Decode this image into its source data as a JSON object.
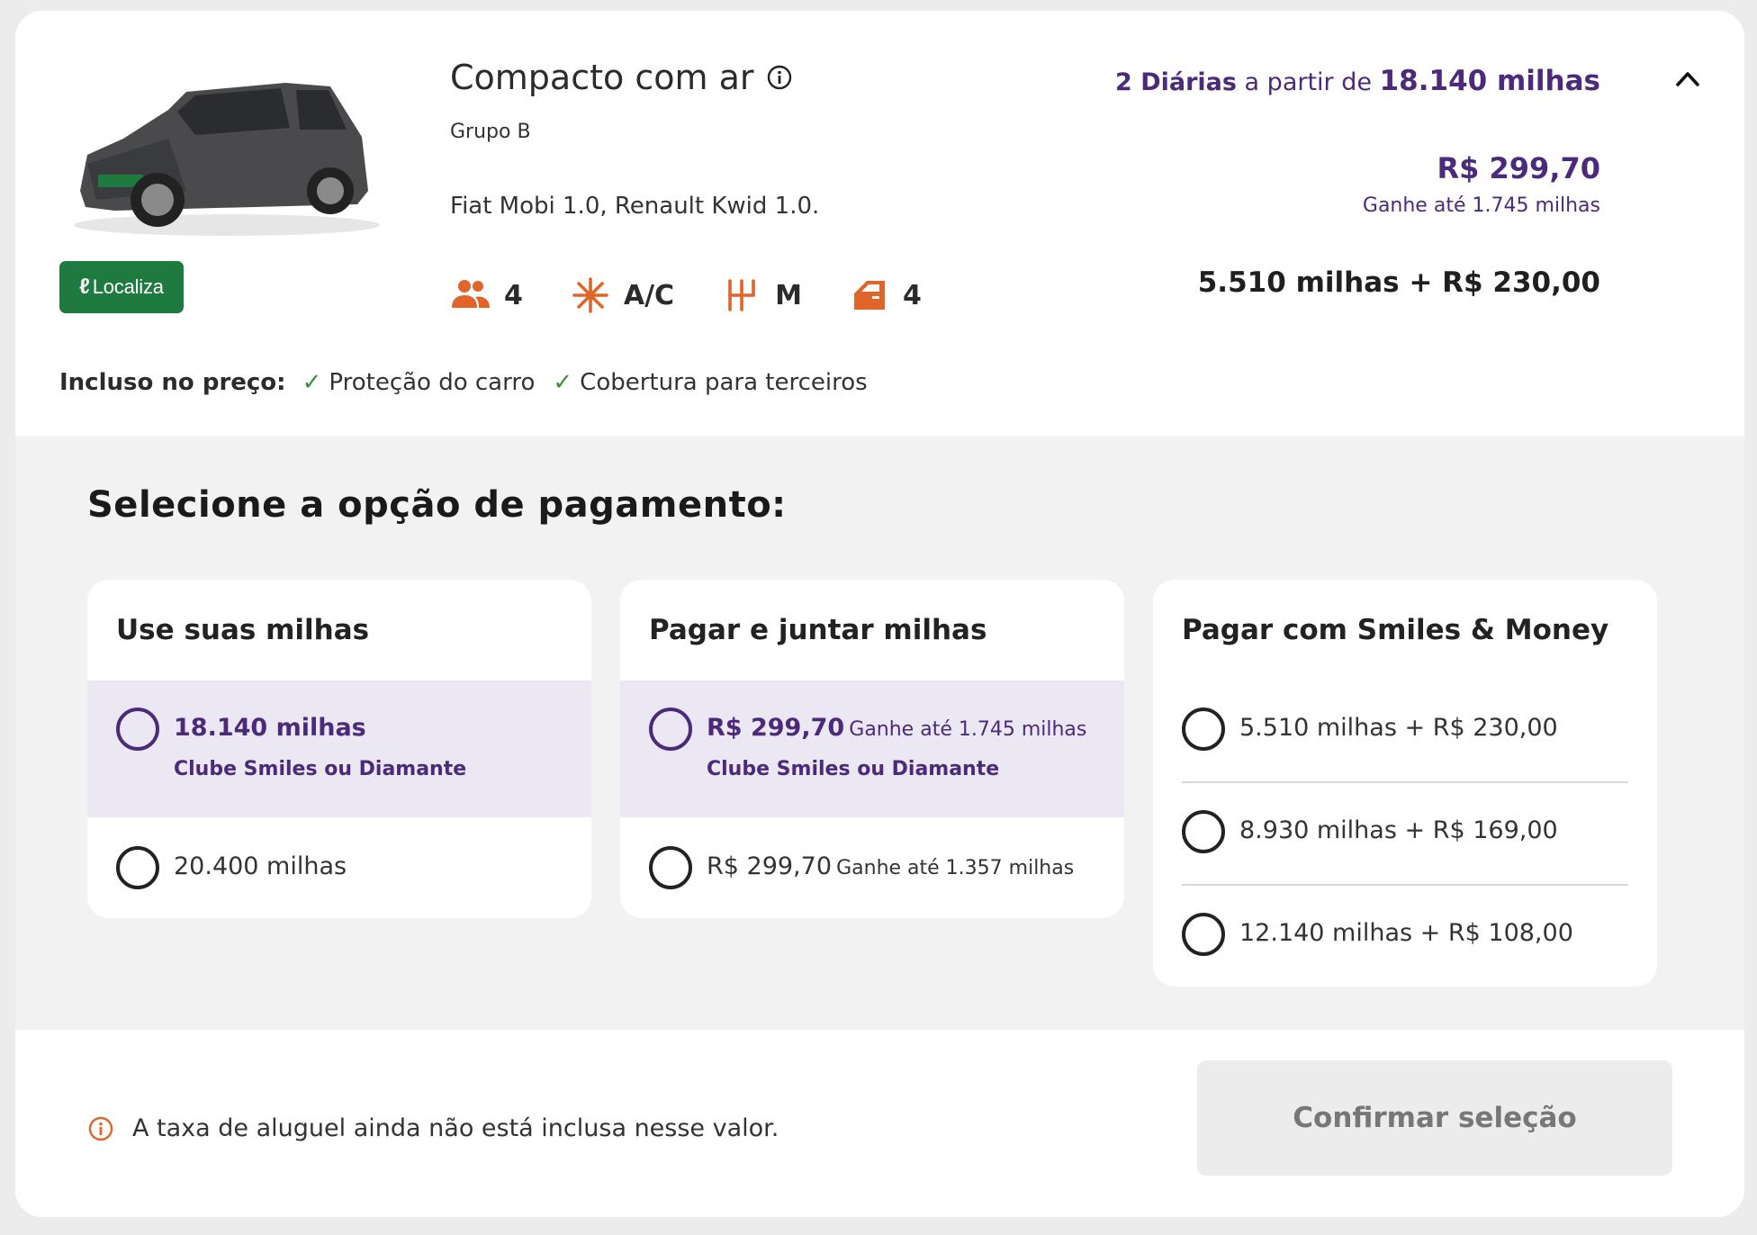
{
  "vehicle": {
    "category_title": "Compacto com ar",
    "group": "Grupo B",
    "models": "Fiat Mobi 1.0, Renault Kwid 1.0.",
    "brand": {
      "name": "Localiza",
      "color": "#1f7a3f"
    },
    "specs": [
      {
        "icon": "passengers-icon",
        "value": "4"
      },
      {
        "icon": "air-conditioning-icon",
        "value": "A/C"
      },
      {
        "icon": "manual-transmission-icon",
        "value": "M"
      },
      {
        "icon": "car-door-icon",
        "value": "4"
      }
    ],
    "included": {
      "label": "Incluso no preço:",
      "items": [
        "Proteção do carro",
        "Cobertura para terceiros"
      ]
    }
  },
  "pricing": {
    "days": "2 Diárias",
    "from_text": "a partir de",
    "from_miles": "18.140 milhas",
    "cash_price": "R$ 299,70",
    "earn_text": "Ganhe até 1.745 milhas",
    "mixed_price": "5.510 milhas + R$ 230,00"
  },
  "payment": {
    "title": "Selecione a opção de pagamento:",
    "options": [
      {
        "title": "Use suas milhas",
        "rows": [
          {
            "main": "18.140 milhas",
            "small": "",
            "sub": "Clube Smiles ou Diamante",
            "highlight": true
          },
          {
            "main": "20.400 milhas",
            "small": "",
            "sub": "",
            "highlight": false
          }
        ]
      },
      {
        "title": "Pagar e juntar milhas",
        "rows": [
          {
            "main": "R$ 299,70",
            "small": "Ganhe até 1.745 milhas",
            "sub": "Clube Smiles ou Diamante",
            "highlight": true
          },
          {
            "main": "R$ 299,70",
            "small": "Ganhe até 1.357 milhas",
            "sub": "",
            "highlight": false
          }
        ]
      },
      {
        "title": "Pagar com Smiles & Money",
        "rows": [
          {
            "main": "5.510 milhas + R$ 230,00"
          },
          {
            "main": "8.930 milhas + R$ 169,00"
          },
          {
            "main": "12.140 milhas + R$ 108,00"
          }
        ]
      }
    ]
  },
  "footer": {
    "notice": "A taxa de aluguel ainda não está inclusa nesse valor.",
    "confirm_label": "Confirmar seleção"
  },
  "colors": {
    "accent_purple": "#4b2a7c",
    "icon_orange": "#e0652a",
    "selected_row_bg": "#ebe7f3"
  }
}
